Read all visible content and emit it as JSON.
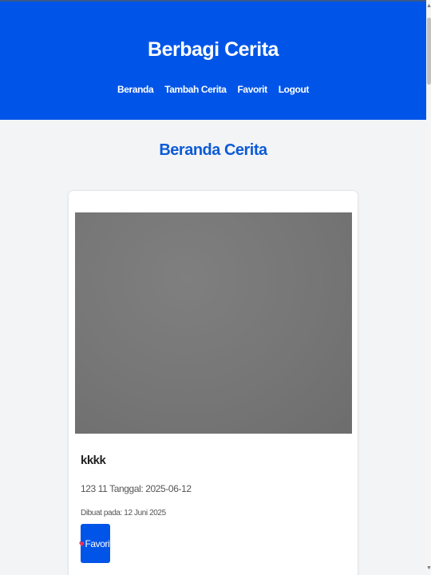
{
  "header": {
    "site_title": "Berbagi Cerita",
    "nav": [
      "Beranda",
      "Tambah Cerita",
      "Favorit",
      "Logout"
    ]
  },
  "main": {
    "page_title": "Beranda Cerita",
    "stories": [
      {
        "title": "kkkk",
        "description": "123 11 Tanggal: 2025-06-12",
        "created": "Dibuat pada: 12 Juni 2025",
        "favorite_label": "Favorit",
        "favorite_icon": "♥"
      }
    ]
  },
  "colors": {
    "header_bg": "#0055e8",
    "accent": "#0d5bd6",
    "heart": "#e8345a"
  }
}
